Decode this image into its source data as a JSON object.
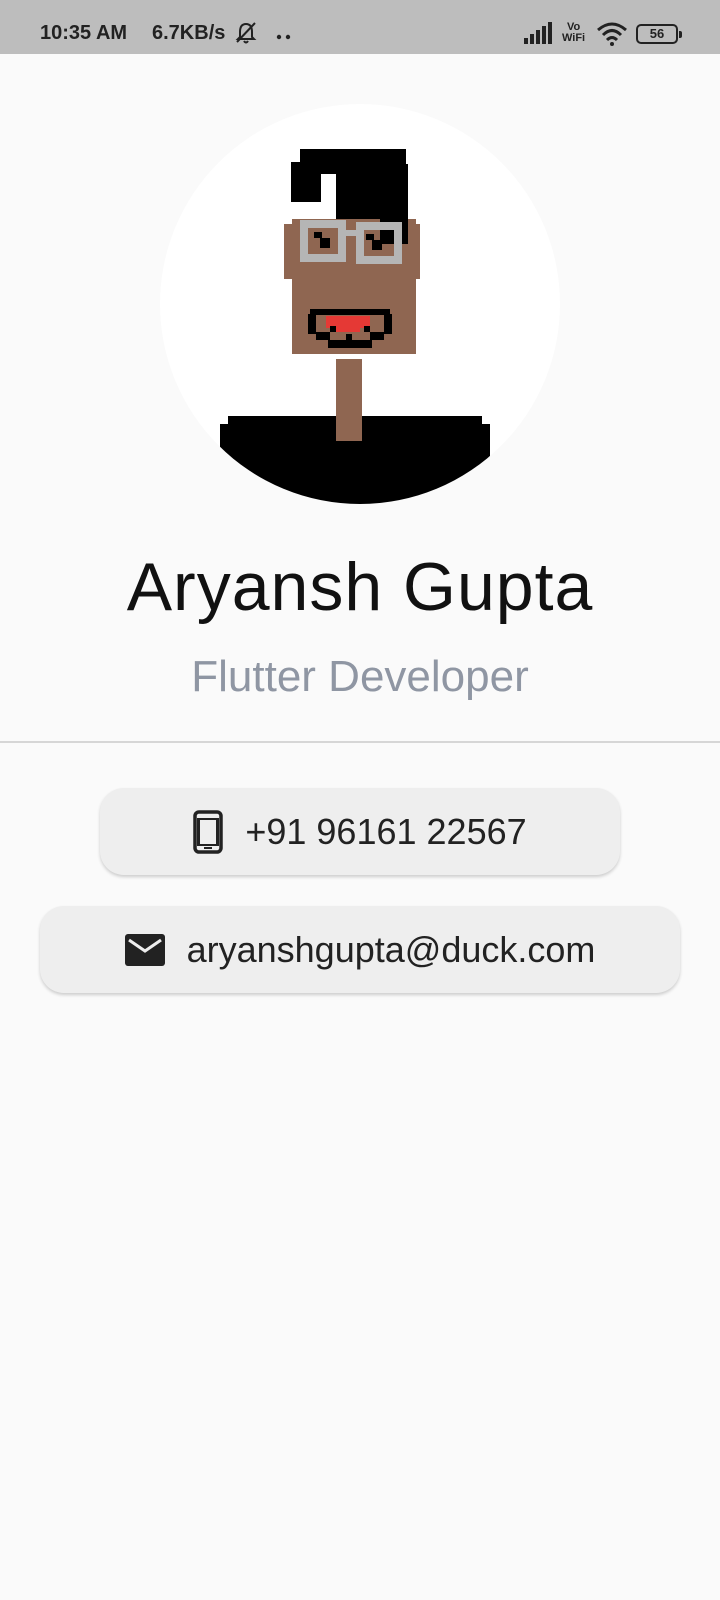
{
  "status_bar": {
    "time": "10:35 AM",
    "network_speed": "6.7KB/s",
    "vowifi_top": "Vo",
    "vowifi_bottom": "WiFi",
    "battery": "56",
    "icons": [
      "bell-off-icon",
      "dots-icon",
      "signal-icon",
      "vowifi-icon",
      "wifi-icon",
      "battery-icon"
    ]
  },
  "profile": {
    "avatar": "pixel-art-avatar",
    "name": "Aryansh Gupta",
    "title": "Flutter Developer"
  },
  "contacts": {
    "phone": {
      "icon": "phone-icon",
      "value": "+91 96161 22567"
    },
    "email": {
      "icon": "mail-icon",
      "value": "aryanshgupta@duck.com"
    }
  },
  "colors": {
    "background": "#fafafa",
    "status_bar": "#bdbdbd",
    "card": "#eeeeee",
    "subtitle": "#8f96a3",
    "skin": "#8f6651",
    "hair": "#000000",
    "glasses": "#b5b5b5",
    "mouth": "#e53935"
  }
}
